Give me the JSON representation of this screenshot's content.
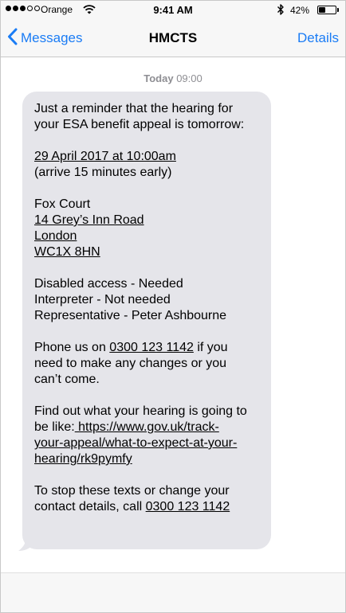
{
  "status_bar": {
    "carrier": "Orange",
    "time": "9:41 AM",
    "battery_percent": "42%",
    "battery_level": 0.42,
    "signal_bars_filled": 3,
    "signal_bars_total": 5
  },
  "nav": {
    "back_label": "Messages",
    "title": "HMCTS",
    "details_label": "Details"
  },
  "timestamp": {
    "day": "Today",
    "time": "09:00"
  },
  "message": {
    "p1": {
      "l1": "Just a reminder that the hearing for",
      "l2": "your ESA benefit appeal is tomorrow:"
    },
    "p2": {
      "date": "29 April 2017 at 10:00am",
      "note": "(arrive 15 minutes early)"
    },
    "p3": {
      "venue": "Fox Court",
      "street": "14 Grey’s Inn Road",
      "city": "London",
      "postcode": "WC1X 8HN"
    },
    "p4": {
      "l1": "Disabled access - Needed",
      "l2": "Interpreter - Not needed",
      "l3": "Representative - Peter Ashbourne"
    },
    "p5": {
      "prefix": "Phone us on ",
      "phone": "0300 123 1142",
      "suffix": " if you",
      "l2": "need to make any changes or you",
      "l3": "can’t come."
    },
    "p6": {
      "l1": "Find out what your hearing is going to",
      "prefix": "be like:",
      "link_l1": " https://www.gov.uk/track-",
      "link_l2": "your-appeal/what-to-expect-at-your-",
      "link_l3": "hearing/rk9pymfy"
    },
    "p7": {
      "l1": "To stop these texts or change your",
      "prefix": "contact details, call ",
      "phone": "0300 123 1142"
    }
  },
  "colors": {
    "accent": "#1a7cf5",
    "bubble": "#e5e5ea",
    "bar_background": "#f7f7f7",
    "timestamp": "#8e8e93"
  },
  "icons": [
    "signal-icon",
    "wifi-icon",
    "bluetooth-icon",
    "battery-icon",
    "chevron-left-icon"
  ]
}
